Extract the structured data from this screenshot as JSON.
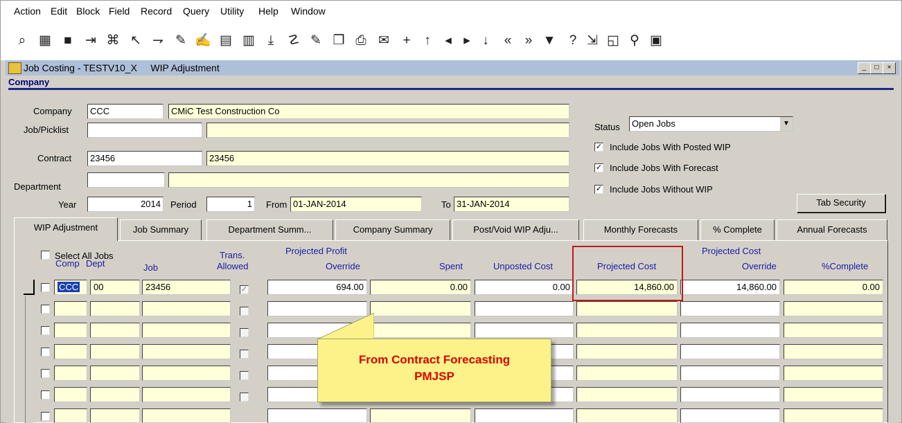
{
  "menu": [
    {
      "label": "Action"
    },
    {
      "label": "Edit"
    },
    {
      "label": "Block"
    },
    {
      "label": "Field"
    },
    {
      "label": "Record"
    },
    {
      "label": "Query"
    },
    {
      "label": "Utility"
    },
    {
      "label": "Help"
    },
    {
      "label": "Window"
    }
  ],
  "toolbar_icons": [
    "enter-query-icon",
    "execute-query-icon",
    "save-icon",
    "exit-icon",
    "print-icon",
    "clear-icon",
    "clear-block-icon",
    "clear-record-icon",
    "new-record-icon",
    "insert-record-icon",
    "remove-record-icon",
    "duplicate-down-icon",
    "list-values-icon",
    "edit-icon",
    "copy-icon",
    "printer-icon",
    "help-page-icon",
    "plus-icon",
    "up-arrow-icon",
    "prev-icon",
    "next-icon",
    "down-arrow-icon",
    "first-icon",
    "last-icon",
    "filter-icon",
    "question-icon",
    "export-icon",
    "report-icon",
    "search-icon",
    "calculator-icon"
  ],
  "window": {
    "app": "Job Costing - TESTV10_X",
    "screen": "WIP Adjustment",
    "min": "_",
    "max": "□",
    "close": "×"
  },
  "section": {
    "title": "Company"
  },
  "form": {
    "company_label": "Company",
    "company_code": "CCC",
    "company_name": "CMiC Test Construction Co",
    "job_label": "Job/Picklist",
    "job_code": "",
    "job_name": "",
    "contract_label": "Contract",
    "contract_code": "23456",
    "contract_name": "23456",
    "department_label": "Department",
    "department_code": "",
    "department_name": "",
    "year_label": "Year",
    "year": "2014",
    "period_label": "Period",
    "period": "1",
    "from_label": "From",
    "from": "01-JAN-2014",
    "to_label": "To",
    "to": "31-JAN-2014",
    "status_label": "Status",
    "status": "Open Jobs",
    "inc_posted": "Include Jobs With Posted WIP",
    "inc_forecast": "Include Jobs With Forecast",
    "inc_without": "Include Jobs Without WIP",
    "tab_security": "Tab Security"
  },
  "tabs": [
    {
      "label": "WIP Adjustment"
    },
    {
      "label": "Job Summary"
    },
    {
      "label": "Department Summ..."
    },
    {
      "label": "Company Summary"
    },
    {
      "label": "Post/Void WIP Adju..."
    },
    {
      "label": "Monthly Forecasts"
    },
    {
      "label": "% Complete"
    },
    {
      "label": "Annual Forecasts"
    }
  ],
  "grid": {
    "select_all": "Select All Jobs",
    "h_comp": "Comp",
    "h_dept": "Dept",
    "h_job": "Job",
    "h_trans1": "Trans.",
    "h_trans2": "Allowed",
    "h_pp1": "Projected Profit",
    "h_pp2": "Override",
    "h_spent": "Spent",
    "h_unposted": "Unposted Cost",
    "h_projcost": "Projected Cost",
    "h_pco1": "Projected Cost",
    "h_pco2": "Override",
    "h_pct": "%Complete",
    "row1": {
      "comp": "CCC",
      "dept": "00",
      "job": "23456",
      "profit": "694.00",
      "spent": "0.00",
      "unposted": "0.00",
      "projcost": "14,860.00",
      "override": "14,860.00",
      "pct": "0.00"
    }
  },
  "callout": {
    "line1": "From Contract Forecasting",
    "line2": "PMJSP"
  }
}
